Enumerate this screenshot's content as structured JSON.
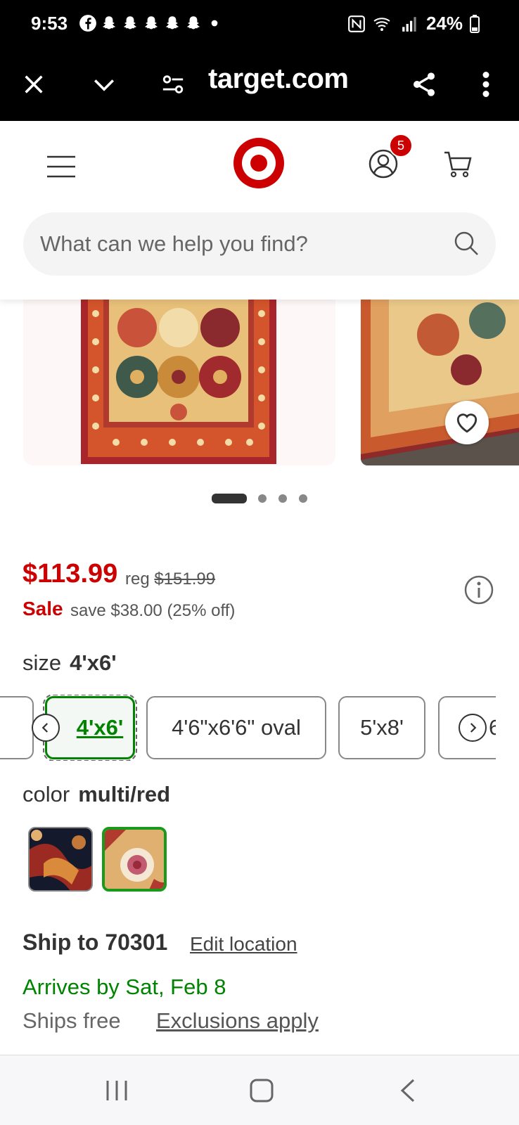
{
  "status_bar": {
    "time": "9:53",
    "notification_icons": [
      "facebook-icon",
      "snapchat-icon",
      "snapchat-icon",
      "snapchat-icon",
      "snapchat-icon",
      "snapchat-icon",
      "dot-icon"
    ],
    "battery": "24%"
  },
  "browser": {
    "url": "target.com",
    "buttons": [
      "close-icon",
      "chevron-down-icon",
      "site-settings-icon",
      "share-icon",
      "more-vertical-icon"
    ]
  },
  "header": {
    "account_badge_count": "5",
    "search_placeholder": "What can we help you find?"
  },
  "carousel": {
    "dot_count": 4,
    "active_index": 0
  },
  "product": {
    "price": "$113.99",
    "reg_label": "reg",
    "reg_price": "$151.99",
    "sale_label": "Sale",
    "save_text": "save $38.00 (25% off)",
    "size_label": "size",
    "size_value": "4'x6'",
    "size_options": [
      {
        "label": "4'x6'",
        "selected": true
      },
      {
        "label": "4'6\"x6'6\" oval",
        "selected": false
      },
      {
        "label": "5'x8'",
        "selected": false
      },
      {
        "label": "6",
        "selected": false
      }
    ],
    "color_label": "color",
    "color_value": "multi/red",
    "color_swatches": [
      {
        "name": "navy",
        "selected": false
      },
      {
        "name": "multi/red",
        "selected": true
      }
    ]
  },
  "shipping": {
    "ship_to": "Ship to 70301",
    "edit_location": "Edit location",
    "arrives": "Arrives by Sat, Feb 8",
    "ships_free": "Ships free",
    "exclusions": "Exclusions apply"
  },
  "colors": {
    "brand_red": "#cc0000",
    "success_green": "#008300"
  }
}
